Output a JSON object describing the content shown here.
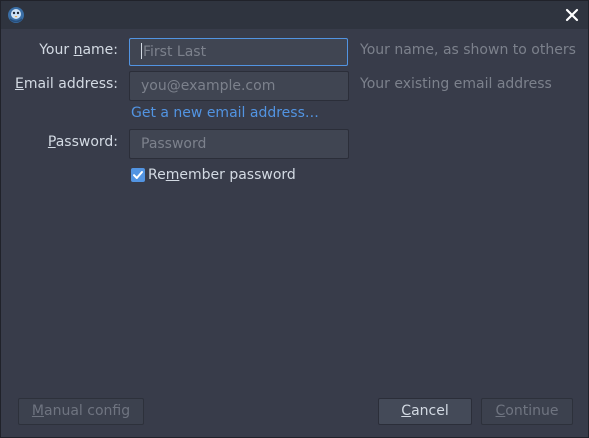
{
  "window": {
    "app_icon": "thunderbird-icon",
    "close_icon": "close-icon"
  },
  "form": {
    "name": {
      "label_pre": "Your ",
      "label_mnemonic": "n",
      "label_post": "ame:",
      "placeholder": "First Last",
      "value": "",
      "hint": "Your name, as shown to others"
    },
    "email": {
      "label_pre": "",
      "label_mnemonic": "E",
      "label_post": "mail address:",
      "placeholder": "you@example.com",
      "value": "",
      "hint": "Your existing email address"
    },
    "new_email_link": "Get a new email address…",
    "password": {
      "label_pre": "",
      "label_mnemonic": "P",
      "label_post": "assword:",
      "placeholder": "Password",
      "value": ""
    },
    "remember": {
      "label_pre": "Re",
      "label_mnemonic": "m",
      "label_post": "ember password",
      "checked": true
    }
  },
  "buttons": {
    "manual_config": {
      "pre": "",
      "mnemonic": "M",
      "post": "anual config"
    },
    "cancel": {
      "pre": "",
      "mnemonic": "C",
      "post": "ancel"
    },
    "continue": {
      "pre": "",
      "mnemonic": "C",
      "post": "ontinue"
    }
  },
  "colors": {
    "background": "#383c4a",
    "accent": "#5294e2",
    "text": "#d3dae3",
    "hint": "#7c818c"
  }
}
